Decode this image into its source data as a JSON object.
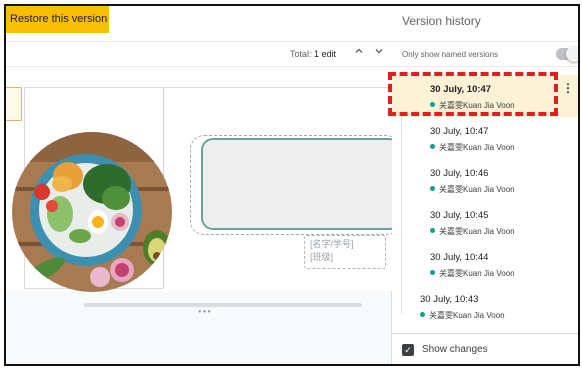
{
  "toolbar": {
    "restore_label": "Restore this version"
  },
  "edits": {
    "total_prefix": "Total:",
    "total_value": "1 edit",
    "up_icon": "chevron-up-icon",
    "down_icon": "chevron-down-icon"
  },
  "document": {
    "placeholder_line1": "[名字/学号]",
    "placeholder_line2": "[班级]"
  },
  "panel": {
    "title": "Version history",
    "named_only_label": "Only show named versions",
    "named_only_on": false,
    "show_changes_label": "Show changes",
    "show_changes_checked": true
  },
  "versions": [
    {
      "date": "30 July, 10:47",
      "author": "关嘉雯Kuan Jia Voon",
      "selected": true
    },
    {
      "date": "30 July, 10:47",
      "author": "关嘉雯Kuan Jia Voon",
      "selected": false
    },
    {
      "date": "30 July, 10:46",
      "author": "关嘉雯Kuan Jia Voon",
      "selected": false
    },
    {
      "date": "30 July, 10:45",
      "author": "关嘉雯Kuan Jia Voon",
      "selected": false
    },
    {
      "date": "30 July, 10:44",
      "author": "关嘉雯Kuan Jia Voon",
      "selected": false
    },
    {
      "date": "30 July, 10:43",
      "author": "关嘉雯Kuan Jia Voon",
      "selected": false
    }
  ],
  "colors": {
    "restore_bg": "#fbbc04",
    "author_dot": "#00a389",
    "selected_bg": "#fdf1d6",
    "highlight_dash": "#e11f1f",
    "shape_border": "#6aa39a"
  }
}
